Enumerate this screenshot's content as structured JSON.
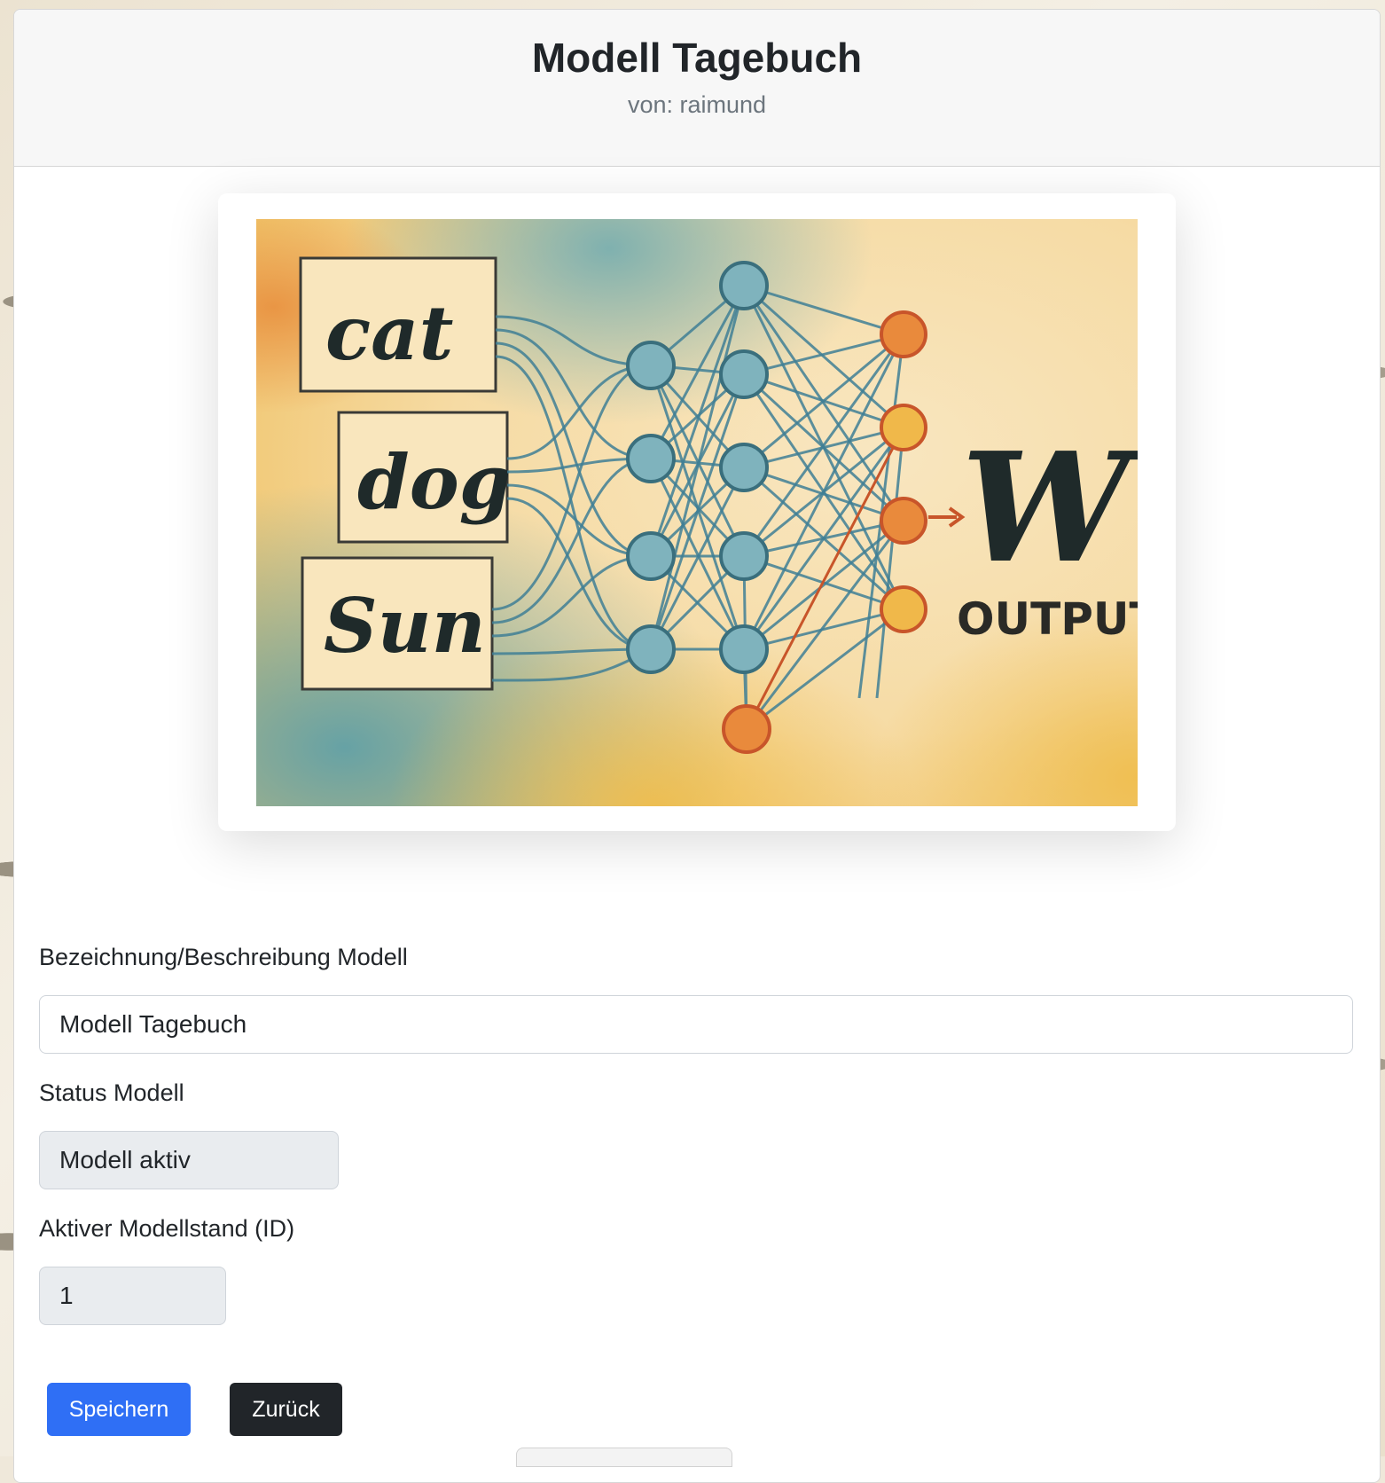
{
  "header": {
    "title": "Modell Tagebuch",
    "subtitle": "von: raimund"
  },
  "illustration": {
    "alt": "neural network illustration",
    "input_words": [
      "cat",
      "dog",
      "Sun"
    ],
    "output_letter": "W",
    "output_label": "OUTPUT"
  },
  "form": {
    "name_label": "Bezeichnung/Beschreibung Modell",
    "name_value": "Modell Tagebuch",
    "status_label": "Status Modell",
    "status_value": "Modell aktiv",
    "version_label": "Aktiver Modellstand (ID)",
    "version_value": "1"
  },
  "buttons": {
    "save": "Speichern",
    "back": "Zurück"
  },
  "colors": {
    "primary": "#2f6ff5",
    "dark": "#212529",
    "node_teal": "#7fb3bd",
    "node_orange": "#e98a3c",
    "node_yellow": "#f0b84a"
  }
}
